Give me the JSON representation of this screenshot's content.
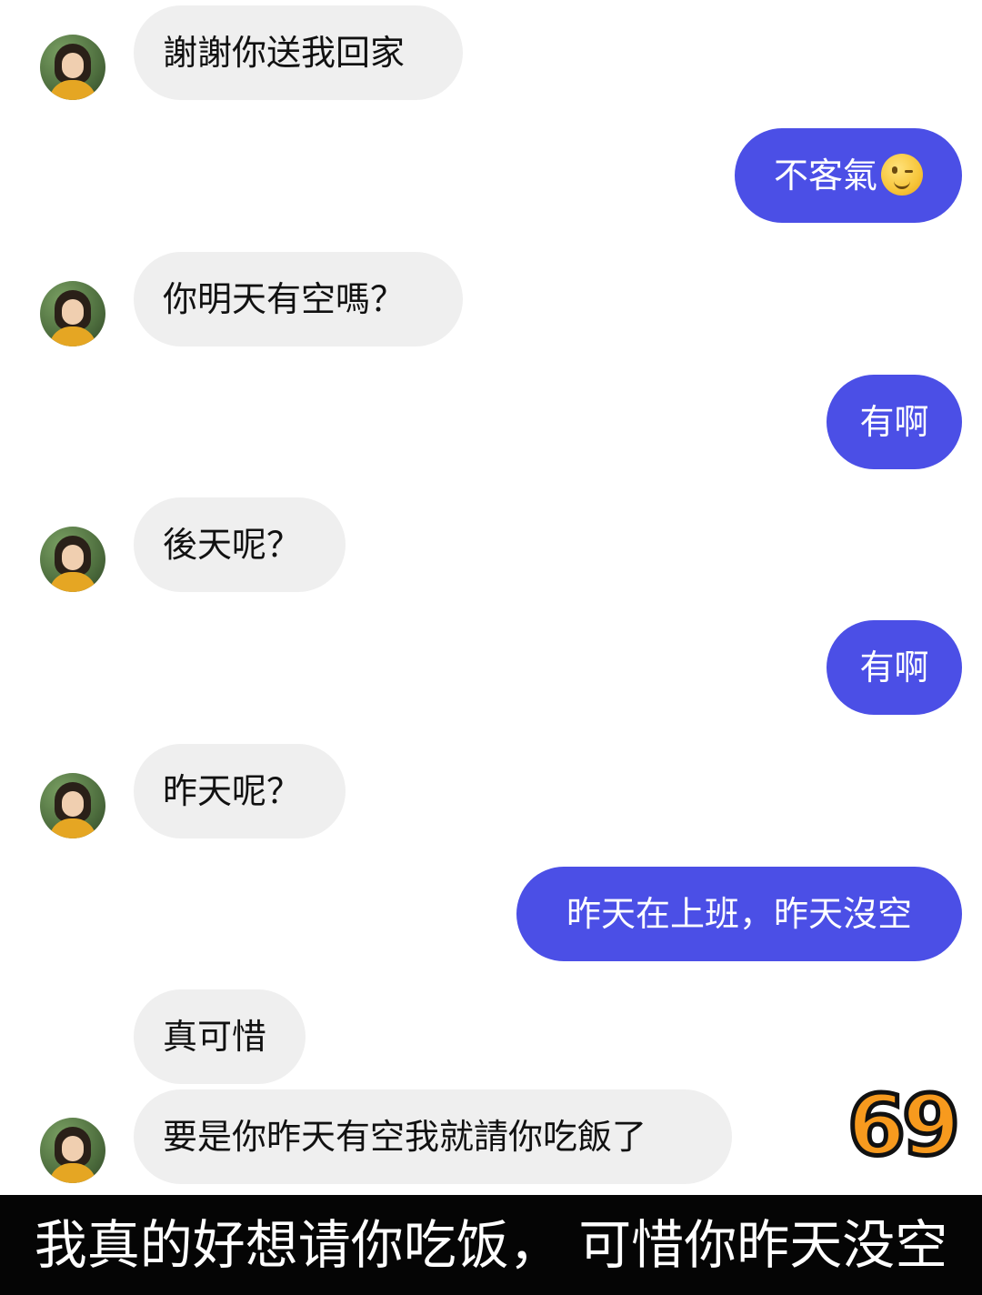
{
  "messages": [
    {
      "side": "incoming",
      "text": "謝謝你送我回家",
      "avatar_icon": "user-avatar"
    },
    {
      "side": "outgoing",
      "text": "不客氣",
      "emoji": "winking-face-icon"
    },
    {
      "side": "incoming",
      "text": "你明天有空嗎？",
      "avatar_icon": "user-avatar"
    },
    {
      "side": "outgoing",
      "text": "有啊"
    },
    {
      "side": "incoming",
      "text": "後天呢？",
      "avatar_icon": "user-avatar"
    },
    {
      "side": "outgoing",
      "text": "有啊"
    },
    {
      "side": "incoming",
      "text": "昨天呢？",
      "avatar_icon": "user-avatar"
    },
    {
      "side": "outgoing",
      "text": "昨天在上班，昨天沒空"
    },
    {
      "side": "incoming",
      "text": "真可惜"
    },
    {
      "side": "incoming",
      "text": "要是你昨天有空我就請你吃飯了",
      "avatar_icon": "user-avatar"
    }
  ],
  "badge": {
    "number": "69",
    "color": "#f79a1e"
  },
  "caption": "我真的好想请你吃饭，  可惜你昨天没空",
  "colors": {
    "incoming_bubble": "#efefef",
    "outgoing_bubble": "#4b4fe6",
    "caption_bg": "#050505"
  }
}
